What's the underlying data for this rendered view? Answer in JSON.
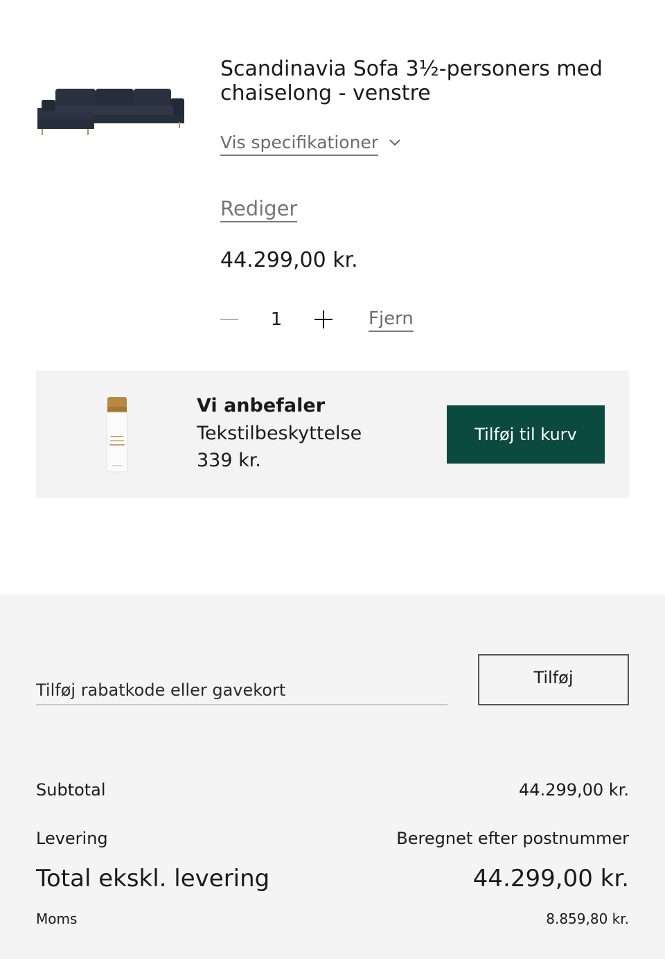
{
  "cart_item": {
    "image_icon": "sofa-image",
    "title": "Scandinavia Sofa 3½-personers med chaiselong - venstre",
    "spec_label": "Vis specifikationer",
    "edit_label": "Rediger",
    "price": "44.299,00 kr.",
    "quantity": "1",
    "remove_label": "Fjern"
  },
  "recommendation": {
    "image_icon": "textile-protector-bottle-image",
    "heading": "Vi anbefaler",
    "name": "Tekstilbeskyttelse",
    "price": "339 kr.",
    "button_label": "Tilføj til kurv"
  },
  "discount": {
    "placeholder": "Tilføj rabatkode eller gavekort",
    "button_label": "Tilføj"
  },
  "summary": {
    "subtotal_label": "Subtotal",
    "subtotal_value": "44.299,00 kr.",
    "delivery_label": "Levering",
    "delivery_value": "Beregnet efter postnummer",
    "total_label": "Total ekskl. levering",
    "total_value": "44.299,00 kr.",
    "vat_label": "Moms",
    "vat_value": "8.859,80 kr."
  },
  "colors": {
    "primary_button": "#0b4a3e",
    "panel_background": "#f3f3f3",
    "text": "#1a1a1a",
    "muted_text": "#6b6b6b"
  }
}
